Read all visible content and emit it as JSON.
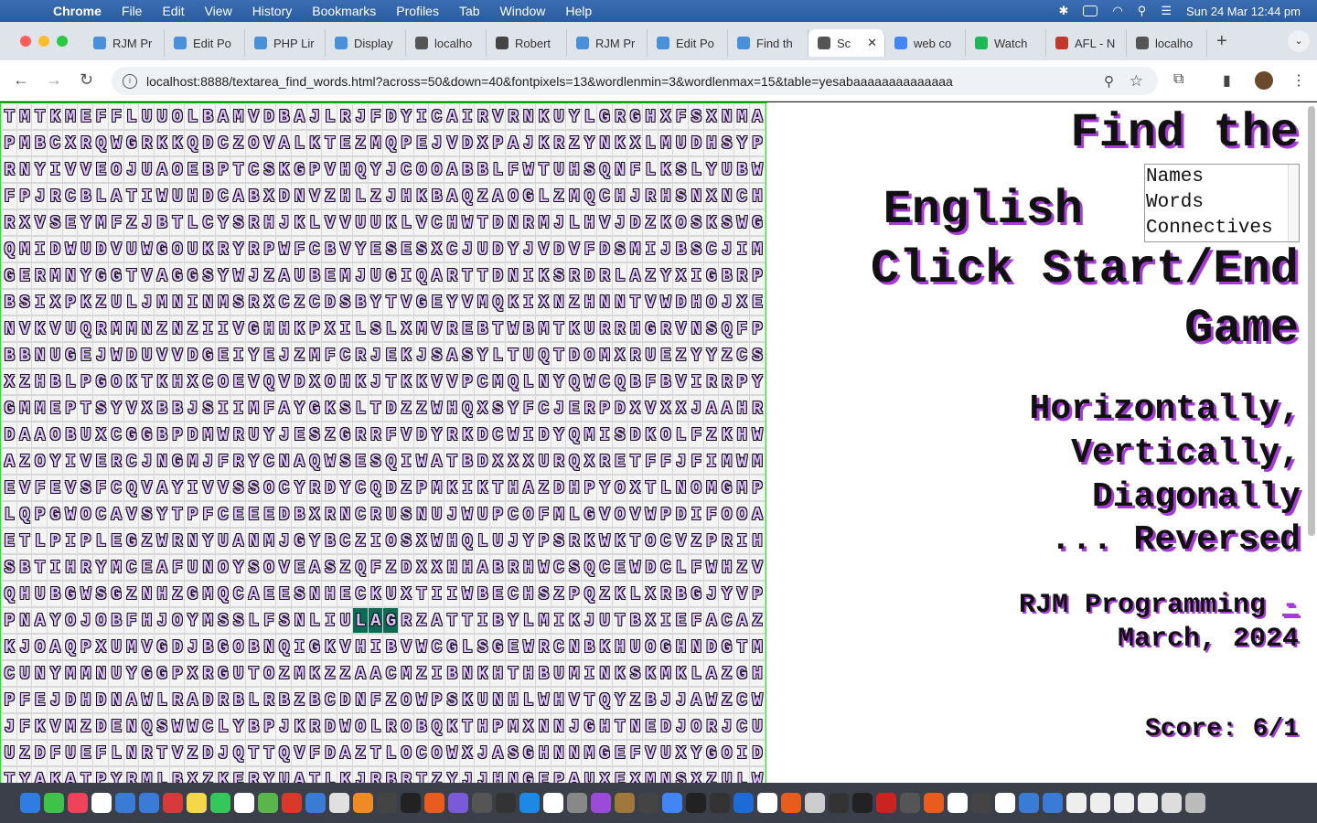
{
  "menubar": {
    "app": "Chrome",
    "items": [
      "File",
      "Edit",
      "View",
      "History",
      "Bookmarks",
      "Profiles",
      "Tab",
      "Window",
      "Help"
    ],
    "clock": "Sun 24 Mar  12:44 pm"
  },
  "tabs": [
    {
      "label": "RJM Pr",
      "color": "#4a90d9"
    },
    {
      "label": "Edit Po",
      "color": "#4a90d9"
    },
    {
      "label": "PHP Lir",
      "color": "#4a90d9"
    },
    {
      "label": "Display",
      "color": "#4a90d9"
    },
    {
      "label": "localho",
      "color": "#555555"
    },
    {
      "label": "Robert",
      "color": "#444444"
    },
    {
      "label": "RJM Pr",
      "color": "#4a90d9"
    },
    {
      "label": "Edit Po",
      "color": "#4a90d9"
    },
    {
      "label": "Find th",
      "color": "#4a90d9"
    },
    {
      "label": "Sc",
      "color": "#555555",
      "active": true
    },
    {
      "label": "web co",
      "color": "#4285f4"
    },
    {
      "label": "Watch",
      "color": "#1db954"
    },
    {
      "label": "AFL - N",
      "color": "#c0392b"
    },
    {
      "label": "localho",
      "color": "#555555"
    }
  ],
  "address": {
    "url": "localhost:8888/textarea_find_words.html?across=50&down=40&fontpixels=13&wordlenmin=3&wordlenmax=15&table=yesabaaaaaaaaaaaaaa"
  },
  "grid": {
    "rows": [
      "TMTKMEFFLUUOLBAMVDBAJLRJFDYICAIRVRNKUYLGRGHXFSXNMA",
      "PMBCXRQWGRKKQDCZOVALKTEZMQPEJVDXPAJKRZYNKXLMUDHSYP",
      "RNYIVVEOJUAOEBPTCSKGPVHQYJCOOABBLFWTUHSQNFLKSLYUBW",
      "FPJRCBLATIWUHDCABXDNVZHLZJHKBAQZAOGLZMQCHJRHSNXNCH",
      "RXVSEYMFZJBTLCYSRHJKLVVUUKLVCHWTDNRMJLHVJDZKOSKSWG",
      "QMIDWUDVUWGOUKRYRPWFCBVYESESXCJUDYJVDVFDSMIJBSCJIM",
      "GERMNYGGTVAGGSYWJZAUBEMJUGIQARTTDNIKSRDRLAZYXIGBRP",
      "BSIXPKZULJMNINMSRXCZCDSBYTVGEYVMQKIXNZHNNTVWDHOJXE",
      "NVKVUQRMMNZNZIIVGHHKPXILSLXMVREBTWBMTKURRHGRVNSQFP",
      "BBNUGEJWDUVVDGEIYEJZMFCRJEKJSASYLTUQTDOMXRUEZYYZCS",
      "XZHBLPGOKTKHXCOEVQVDXOHKJTKKVVPCMQLNYQWCQBFBVIRRPY",
      "GMMEPTSYVXBBJSIIMFAYGKSLTDZZWHQXSYFCJERPDXVXXJAAHR",
      "DAAOBUXCGGBPDMWRUYJESZGRRFVDYRKDCWIDYQMISDKOLFZKHW",
      "AZOYIVERCJNGMJFRYCNAQWSESQIWATBDXXXURQXRETFFJFIMWM",
      "EVFEVSFCQVAYIVVSSOCYRDYCQDZPMKIKTHAZDHPYOXTLNOMGMP",
      "LQPGWOCAVSYTPFCEEEDBXRNCRUSNUJWUPCOFMLGVOVWPDIFOOA",
      "ETLPIPLEGZWRNYUANMJGYBCZIOSXWHQLUJYPSRKWKTOCVZPRIH",
      "SBTIHRYMCEAFUNOYSOVEASZQFZDXXHHABRHWCSQCEWDCLFWHZV",
      "QHUBGWSGZNHZGMQCAEESNHECKUXTIIWBECHSZPQZKLXRBGJYVP",
      "PNAYOJOBFHJOYMSSLFSNLIULAGRZATTIBYLMIKJUTBXIEFACAZ",
      "KJOAQPXUMVGDJBGOBNQIGKVHIBVWCGLSGEWRCNBKHUOGHNDGTM",
      "CUNYMMNUYGGPXRGUTOZMKZZAACMZIBNKHTHBUMINKSKMKLAZGH",
      "PFEJDHDNAWLRADRBLRBZBCDNFZOWPSKUNHLWHVTQYZBJJAWZCW",
      "JFKVMZDENQSWWCLYBPJKRDWOLROBQKTHPMXNNJGHTNEDJORJCU",
      "UZDFUEFLNRTVZDJQTTQVFDAZTLOCOWXJASGHNNMGEFVUXYGOID",
      "TYAKATPYRMLBXZKERYUATLKJRBRTZYJJHNGEPAUXEXMNSXZULW"
    ],
    "selected": {
      "row": 19,
      "cols": [
        23,
        24,
        25
      ]
    }
  },
  "right": {
    "title_line1": "Find the",
    "title_line2": "English",
    "title_line3": "Click Start/End",
    "title_line4": "Game",
    "listbox_options": [
      "Names",
      "Words",
      "Connectives"
    ],
    "dir1": "Horizontally,",
    "dir2": "Vertically,",
    "dir3": "Diagonally",
    "dir4": "... Reversed",
    "credit_name": "RJM Programming ",
    "credit_dash": "-",
    "credit_date": "March,  2024",
    "score": "Score: 6/1"
  },
  "colors": {
    "grid_background": "#00ff00",
    "letter_fill": "#e0bfff",
    "selected_cell": "#0d6a55",
    "title_shadow": "#a63bd8"
  },
  "dock_colors": [
    "#2f7de1",
    "#3ec24a",
    "#f0435b",
    "#ffffff",
    "#3a7bd5",
    "#3a7bd5",
    "#d63a3a",
    "#f5d84a",
    "#34c759",
    "#ffffff",
    "#5ab54a",
    "#d83a2a",
    "#3a7bd5",
    "#e0e0e0",
    "#f08a24",
    "#444",
    "#222",
    "#e85d1e",
    "#7a5ad6",
    "#555",
    "#333",
    "#1e88e5",
    "#fff",
    "#888",
    "#9b4bd8",
    "#a0783c",
    "#444",
    "#4285f4",
    "#222",
    "#333",
    "#1e6ad6",
    "#fff",
    "#e85d1e",
    "#ccc",
    "#333",
    "#222",
    "#c22",
    "#555",
    "#e85d1e",
    "#fff",
    "#444",
    "#fff",
    "#3a7bd5",
    "#3a7bd5",
    "#eee",
    "#eee",
    "#eee",
    "#eee",
    "#ddd",
    "#bbb"
  ]
}
